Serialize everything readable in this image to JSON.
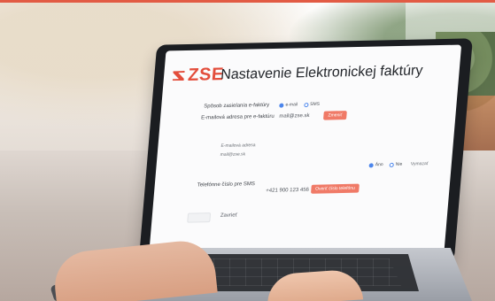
{
  "page": {
    "brand": "ZSE",
    "title": "Nastavenie Elektronickej faktúry"
  },
  "form": {
    "method_label": "Spôsob zasielania e-faktúry",
    "method_option_email": "e-mail",
    "method_option_sms": "SMS",
    "email_label": "E-mailová adresa pre e-faktúru",
    "email_value": "mail@zse.sk",
    "email_button": "Zmeniť",
    "email_section_label": "E-mailová adresa",
    "email_section_value": "mail@zse.sk",
    "choice_yes": "Áno",
    "choice_no": "Nie",
    "choice_link": "Vymazať",
    "phone_label": "Telefónne číslo pre SMS",
    "phone_value": "+421 900 123 456",
    "phone_button": "Overiť číslo telefónu",
    "close_label": "Zavrieť"
  }
}
